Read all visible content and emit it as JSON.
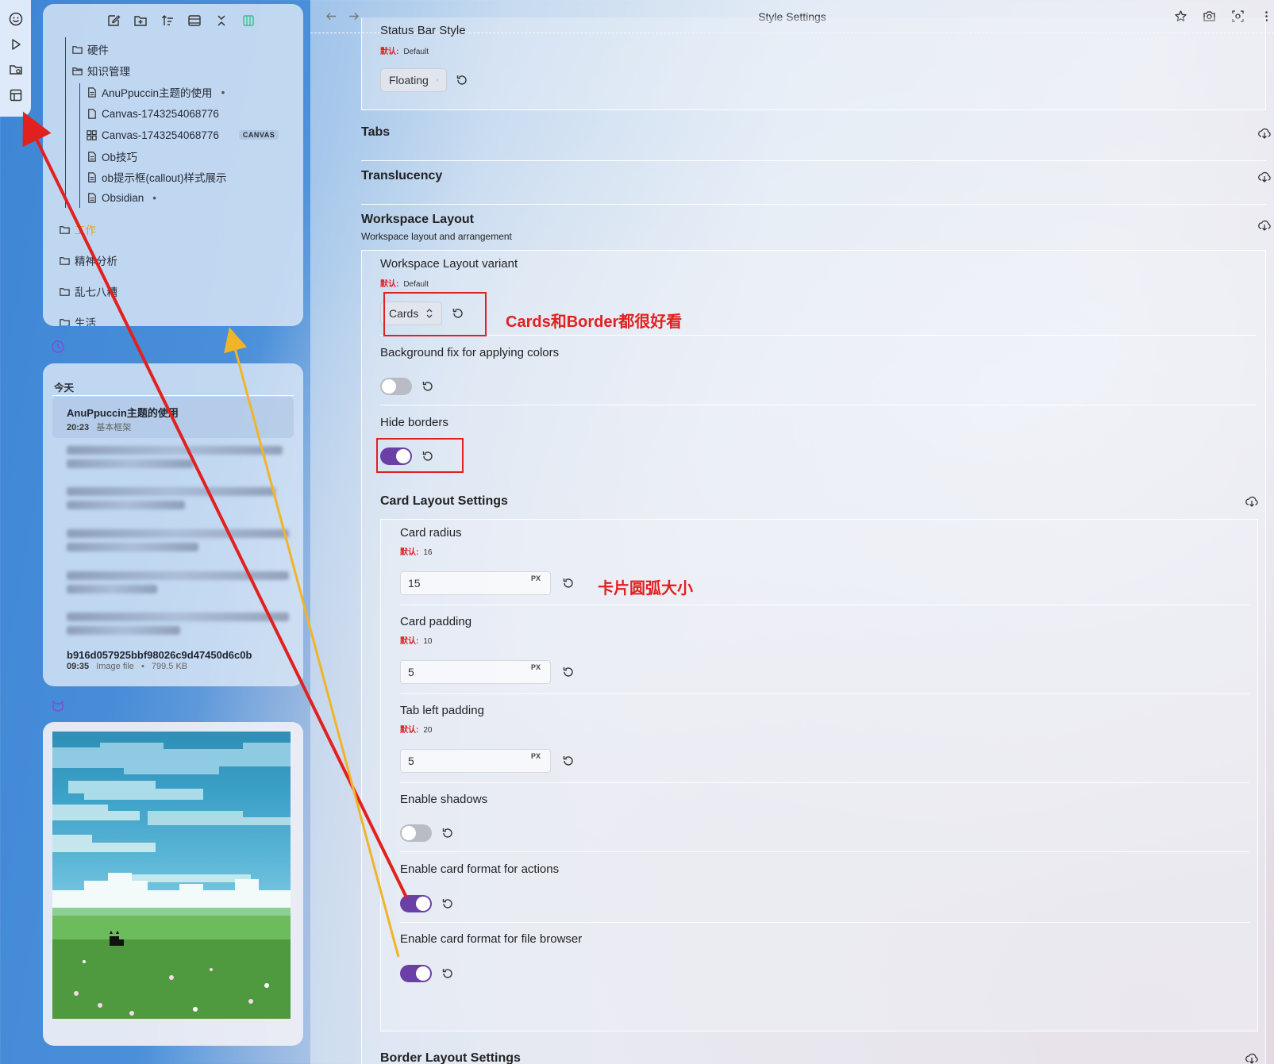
{
  "window": {
    "title": "Style Settings"
  },
  "file_tree": {
    "items": [
      {
        "label": "硬件",
        "kind": "folder"
      },
      {
        "label": "知识管理",
        "kind": "folder-open"
      },
      {
        "label": "AnuPpuccin主题的使用",
        "kind": "file",
        "dot": "•"
      },
      {
        "label": "Canvas-1743254068776",
        "kind": "file"
      },
      {
        "label": "Canvas-1743254068776",
        "kind": "canvas",
        "tag": "CANVAS"
      },
      {
        "label": "Ob技巧",
        "kind": "file"
      },
      {
        "label": "ob提示框(callout)样式展示",
        "kind": "file"
      },
      {
        "label": "Obsidian",
        "kind": "file",
        "dot": "•"
      },
      {
        "label": "工作",
        "kind": "folder"
      },
      {
        "label": "精神分析",
        "kind": "folder"
      },
      {
        "label": "乱七八糟",
        "kind": "folder"
      },
      {
        "label": "生活",
        "kind": "folder"
      }
    ]
  },
  "recent": {
    "heading": "今天",
    "active": {
      "title": "AnuPpuccin主题的使用",
      "time": "20:23",
      "sub": "基本框架"
    },
    "last": {
      "title": "b916d057925bbf98026c9d47450d6c0b",
      "time": "09:35",
      "type": "Image file",
      "sep": "•",
      "size": "799.5 KB"
    }
  },
  "settings": {
    "default_label": "默认:",
    "status_bar": {
      "name": "Status Bar Style",
      "default": "Default",
      "value": "Floating"
    },
    "tabs": {
      "title": "Tabs"
    },
    "translucency": {
      "title": "Translucency"
    },
    "workspace": {
      "title": "Workspace Layout",
      "subtitle": "Workspace layout and arrangement",
      "variant": {
        "name": "Workspace Layout variant",
        "default": "Default",
        "value": "Cards"
      },
      "bgfix": {
        "name": "Background fix for applying colors",
        "on": false
      },
      "hide_borders": {
        "name": "Hide borders",
        "on": true
      }
    },
    "card_layout": {
      "title": "Card Layout Settings",
      "radius": {
        "name": "Card radius",
        "default": "16",
        "value": "15",
        "unit": "PX"
      },
      "padding": {
        "name": "Card padding",
        "default": "10",
        "value": "5",
        "unit": "PX"
      },
      "tab_left": {
        "name": "Tab left padding",
        "default": "20",
        "value": "5",
        "unit": "PX"
      },
      "shadows": {
        "name": "Enable shadows",
        "on": false
      },
      "actions": {
        "name": "Enable card format for actions",
        "on": true
      },
      "file_browser": {
        "name": "Enable card format for file browser",
        "on": true
      }
    },
    "border_layout": {
      "title": "Border Layout Settings"
    }
  },
  "annotations": {
    "note1": "Cards和Border都很好看",
    "note2": "卡片圆弧大小",
    "color_red": "#e0211f",
    "color_yellow": "#f0b429"
  }
}
